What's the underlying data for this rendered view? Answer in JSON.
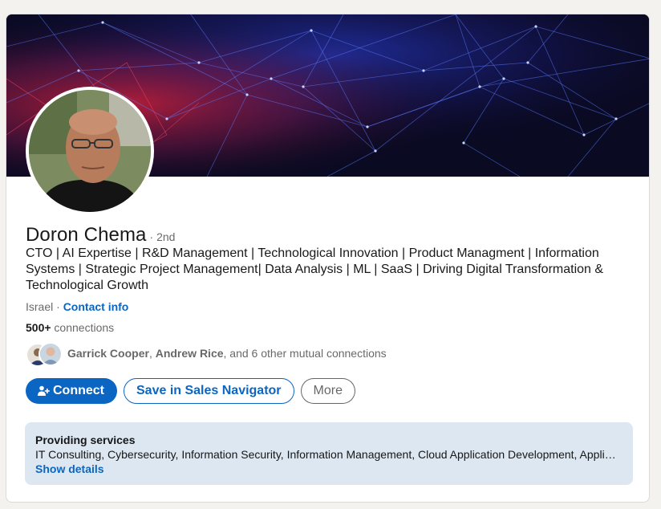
{
  "profile": {
    "name": "Doron Chema",
    "degree": "· 2nd",
    "headline": "CTO | AI Expertise | R&D Management | Technological Innovation | Product Managment | Information Systems | Strategic Project Management| Data Analysis | ML | SaaS | Driving Digital Transformation & Technological Growth",
    "location": "Israel",
    "location_separator": " · ",
    "contact_info": "Contact info",
    "connections_count": "500+",
    "connections_label": " connections"
  },
  "mutual": {
    "name1": "Garrick Cooper",
    "sep1": ", ",
    "name2": "Andrew Rice",
    "rest": ", and 6 other mutual connections"
  },
  "actions": {
    "connect": "Connect",
    "save_sales_nav": "Save in Sales Navigator",
    "more": "More"
  },
  "services": {
    "title": "Providing services",
    "list": "IT Consulting, Cybersecurity, Information Security, Information Management, Cloud Application Development, Application Development, Software Development",
    "show_details": "Show details"
  },
  "colors": {
    "brand_blue": "#0a66c2",
    "services_bg": "#dde7f1",
    "banner_bg": "#0a0a22"
  },
  "icons": {
    "connect": "person-add-icon"
  }
}
